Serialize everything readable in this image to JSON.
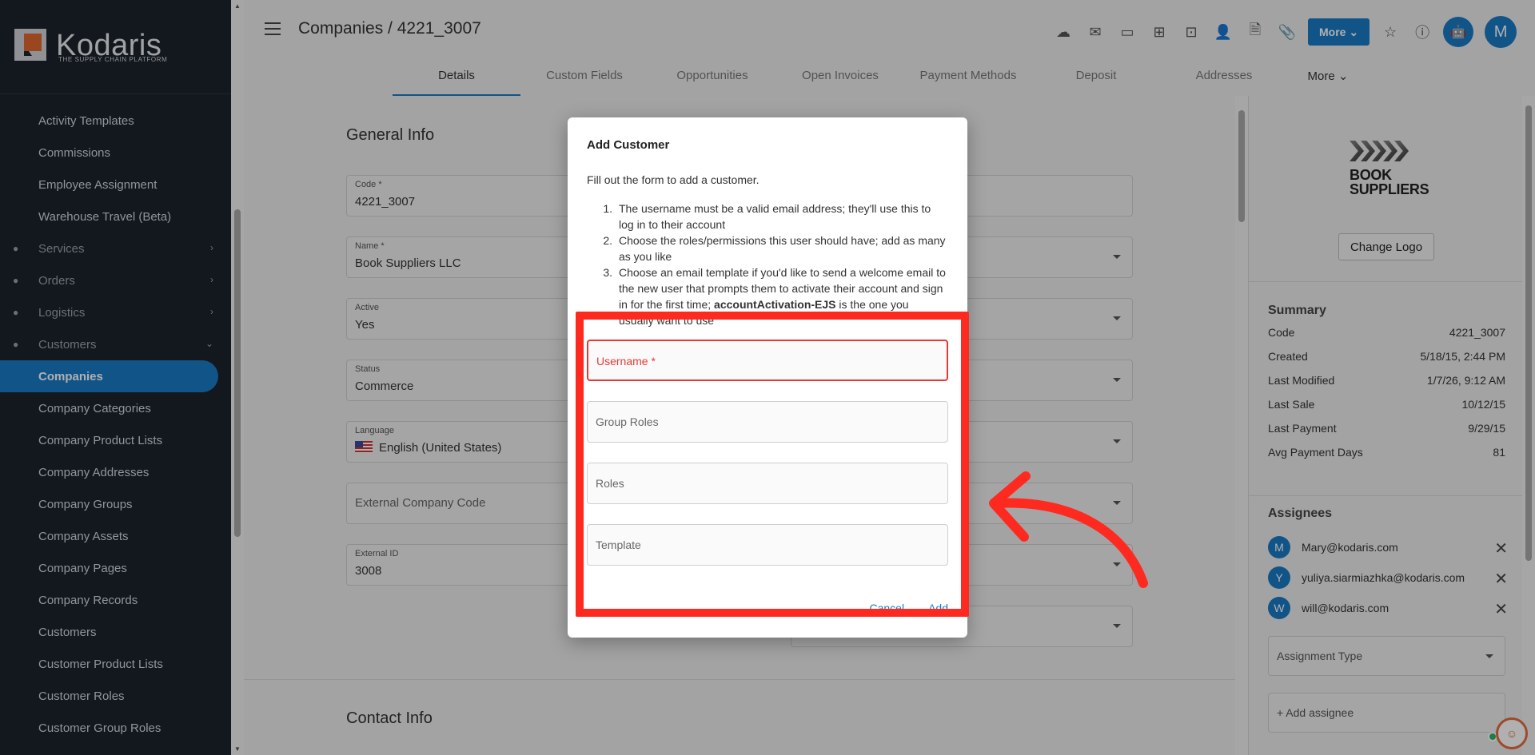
{
  "brand": {
    "name": "Kodaris",
    "tagline": "THE SUPPLY CHAIN PLATFORM"
  },
  "sidebar": {
    "items": [
      {
        "label": "Activity Templates",
        "type": "sub"
      },
      {
        "label": "Commissions",
        "type": "sub"
      },
      {
        "label": "Employee Assignment",
        "type": "sub"
      },
      {
        "label": "Warehouse Travel (Beta)",
        "type": "sub"
      },
      {
        "label": "Services",
        "type": "group",
        "icon": "gears-icon",
        "chevron": "›"
      },
      {
        "label": "Orders",
        "type": "group",
        "icon": "truck-icon",
        "chevron": "›"
      },
      {
        "label": "Logistics",
        "type": "group",
        "icon": "delivery-icon",
        "chevron": "›"
      },
      {
        "label": "Customers",
        "type": "group",
        "icon": "people-icon",
        "chevron": "⌄"
      },
      {
        "label": "Companies",
        "type": "sub",
        "active": true
      },
      {
        "label": "Company Categories",
        "type": "sub"
      },
      {
        "label": "Company Product Lists",
        "type": "sub"
      },
      {
        "label": "Company Addresses",
        "type": "sub"
      },
      {
        "label": "Company Groups",
        "type": "sub"
      },
      {
        "label": "Company Assets",
        "type": "sub"
      },
      {
        "label": "Company Pages",
        "type": "sub"
      },
      {
        "label": "Company Records",
        "type": "sub"
      },
      {
        "label": "Customers",
        "type": "sub"
      },
      {
        "label": "Customer Product Lists",
        "type": "sub"
      },
      {
        "label": "Customer Roles",
        "type": "sub"
      },
      {
        "label": "Customer Group Roles",
        "type": "sub"
      }
    ]
  },
  "header": {
    "title": "Companies / 4221_3007",
    "more_label": "More",
    "avatar_initial": "M",
    "tabs": [
      "Details",
      "Custom Fields",
      "Opportunities",
      "Open Invoices",
      "Payment Methods",
      "Deposit",
      "Addresses"
    ],
    "tabs_more": "More"
  },
  "general": {
    "title": "General Info",
    "code_label": "Code *",
    "code_value": "4221_3007",
    "name_label": "Name *",
    "name_value": "Book Suppliers LLC",
    "active_label": "Active",
    "active_value": "Yes",
    "status_label": "Status",
    "status_value": "Commerce",
    "language_label": "Language",
    "language_value": "English (United States)",
    "ext_code_placeholder": "External Company Code",
    "ext_id_label": "External ID",
    "ext_id_value": "3008"
  },
  "contact": {
    "title": "Contact Info"
  },
  "right_panel": {
    "logo_line1": "BOOK",
    "logo_line2": "SUPPLIERS",
    "change_logo": "Change Logo",
    "summary_title": "Summary",
    "summary": [
      {
        "label": "Code",
        "value": "4221_3007"
      },
      {
        "label": "Created",
        "value": "5/18/15, 2:44 PM"
      },
      {
        "label": "Last Modified",
        "value": "1/7/26, 9:12 AM"
      },
      {
        "label": "Last Sale",
        "value": "10/12/15"
      },
      {
        "label": "Last Payment",
        "value": "9/29/15"
      },
      {
        "label": "Avg Payment Days",
        "value": "81"
      }
    ],
    "assignees_title": "Assignees",
    "assignees": [
      {
        "initial": "M",
        "email": "Mary@kodaris.com"
      },
      {
        "initial": "Y",
        "email": "yuliya.siarmiazhka@kodaris.com"
      },
      {
        "initial": "W",
        "email": "will@kodaris.com"
      }
    ],
    "assignment_type_placeholder": "Assignment Type",
    "add_assignee_placeholder": "+ Add assignee"
  },
  "modal": {
    "title": "Add Customer",
    "description": "Fill out the form to add a customer.",
    "steps": [
      {
        "n": "1.",
        "text": "The username must be a valid email address; they'll use this to log in to their account"
      },
      {
        "n": "2.",
        "text": "Choose the roles/permissions this user should have; add as many as you like"
      },
      {
        "n": "3.",
        "pre": "Choose an email template if you'd like to send a welcome email to the new user that prompts them to activate their account and sign in for the first time; ",
        "bold": "accountActivation-EJS",
        "post": " is the one you usually want to use"
      }
    ],
    "username_placeholder": "Username *",
    "group_roles_placeholder": "Group Roles",
    "roles_placeholder": "Roles",
    "template_placeholder": "Template",
    "cancel": "Cancel",
    "add": "Add"
  },
  "colors": {
    "accent": "#1a7ac6",
    "highlight": "#ff2a1f",
    "error": "#e53935",
    "sidebar": "#1c232c"
  }
}
